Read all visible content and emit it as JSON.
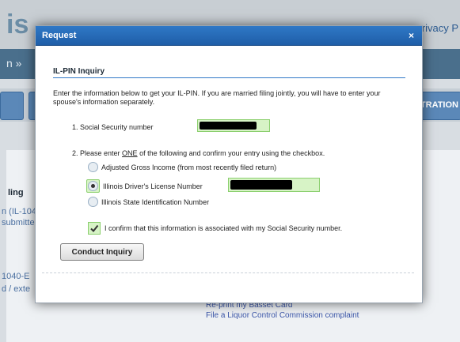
{
  "background": {
    "logo_text": "is",
    "privacy_text": "rivacy P",
    "breadcrumb": "n »",
    "right_button_text": "TRATION",
    "side_heading": "ling",
    "side_line1": "n (IL-104",
    "side_line2": "submitte",
    "side_line3": "1040-E",
    "side_line4": "d / exte",
    "links": [
      "Re-print my Basset Card",
      "File a Liquor Control Commission complaint"
    ]
  },
  "modal": {
    "title": "Request",
    "close_label": "×",
    "section_title": "IL-PIN Inquiry",
    "intro": "Enter the information below to get your IL-PIN. If you are married filing jointly, you will have to enter your spouse's information separately.",
    "step1_label": "1.  Social Security number",
    "step2_prefix": "2.  Please enter ",
    "step2_one": "ONE",
    "step2_suffix": " of the following and confirm your entry using the checkbox.",
    "options": [
      {
        "label": "Adjusted Gross Income (from most recently filed return)",
        "selected": false
      },
      {
        "label": "Illinois Driver's License Number",
        "selected": true
      },
      {
        "label": "Illinois State Identification Number",
        "selected": false
      }
    ],
    "confirm_label": "I confirm that this information is associated with my Social Security number.",
    "confirm_checked": true,
    "button_label": "Conduct Inquiry"
  }
}
